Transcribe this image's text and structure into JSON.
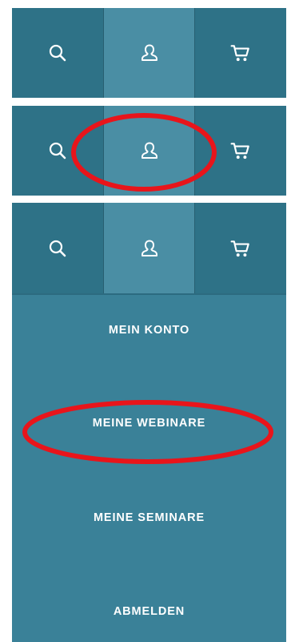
{
  "colors": {
    "nav_bg": "#2e7287",
    "nav_active": "#4a8ea4",
    "menu_bg": "#3a8198",
    "highlight": "#e8151b"
  },
  "nav": {
    "items": [
      {
        "icon": "search-icon"
      },
      {
        "icon": "user-icon",
        "active": true
      },
      {
        "icon": "cart-icon"
      }
    ]
  },
  "menu": {
    "items": [
      {
        "label": "MEIN KONTO"
      },
      {
        "label": "MEINE WEBINARE"
      },
      {
        "label": "MEINE SEMINARE"
      },
      {
        "label": "ABMELDEN"
      }
    ]
  }
}
